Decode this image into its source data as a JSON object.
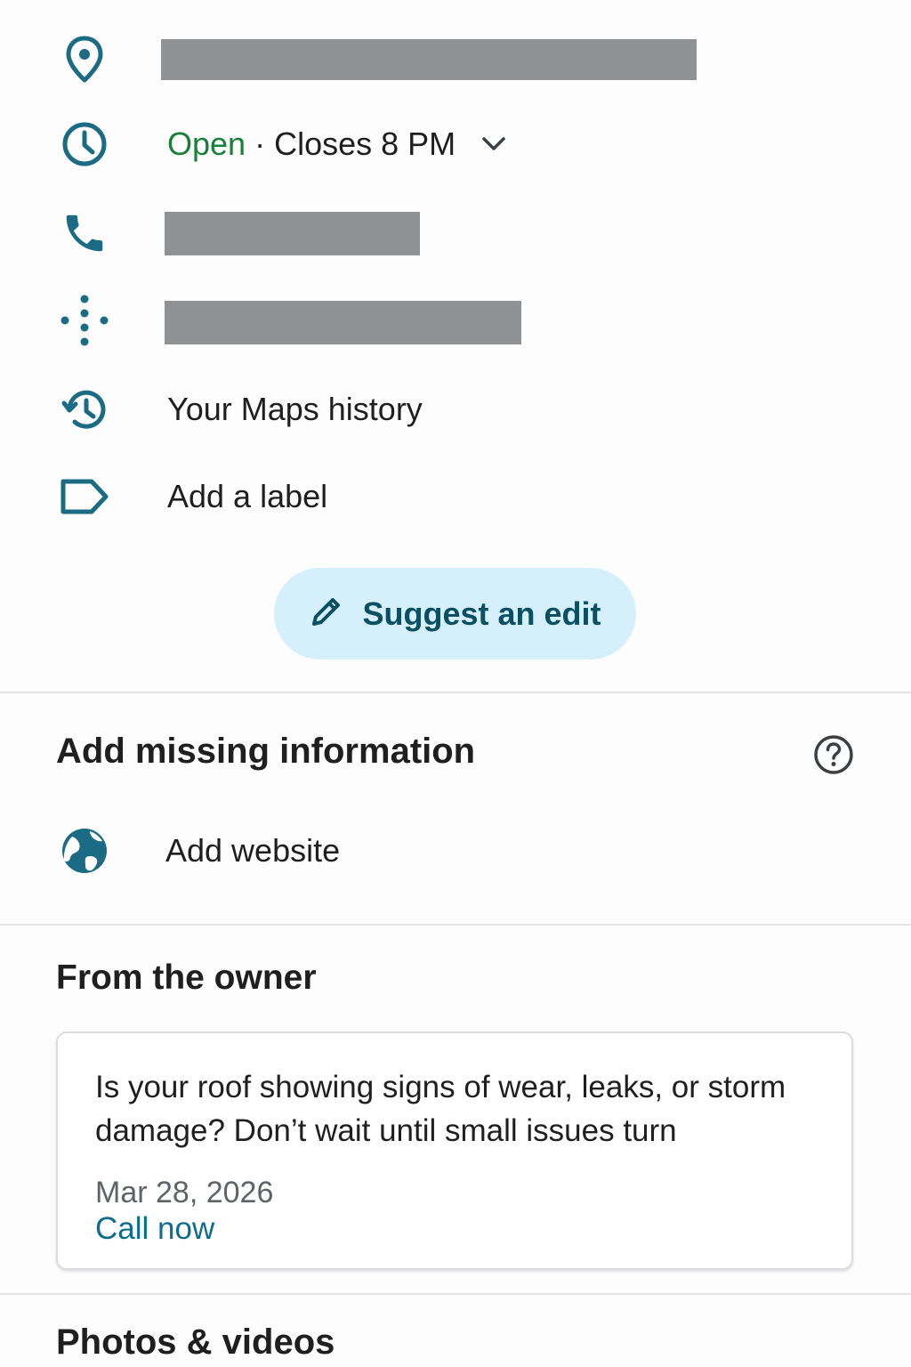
{
  "info_rows": {
    "address": {
      "icon": "location-pin-icon",
      "redacted": true
    },
    "hours": {
      "icon": "clock-icon",
      "status": "Open",
      "separator": "·",
      "closes": "Closes 8 PM",
      "expand_icon": "chevron-down-icon"
    },
    "phone": {
      "icon": "phone-icon",
      "redacted": true
    },
    "plus_code": {
      "icon": "plus-code-icon",
      "redacted": true
    },
    "history": {
      "icon": "history-icon",
      "label": "Your Maps history"
    },
    "label": {
      "icon": "label-icon",
      "label": "Add a label"
    }
  },
  "suggest_edit": {
    "icon": "pencil-icon",
    "label": "Suggest an edit"
  },
  "missing_info": {
    "title": "Add missing information",
    "help_icon": "help-icon",
    "website": {
      "icon": "globe-icon",
      "label": "Add website"
    }
  },
  "owner": {
    "title": "From the owner",
    "post_text": "Is your roof showing signs of wear, leaks, or storm damage? Don’t wait until small issues turn",
    "date": "Mar 28, 2026",
    "cta": "Call now"
  },
  "photos": {
    "title": "Photos & videos"
  },
  "colors": {
    "icon_teal": "#1b6b84",
    "open_green": "#188038",
    "button_bg": "#d6f0fb",
    "button_text": "#0b4f63",
    "redaction": "#909193",
    "link": "#0b6e8a"
  }
}
